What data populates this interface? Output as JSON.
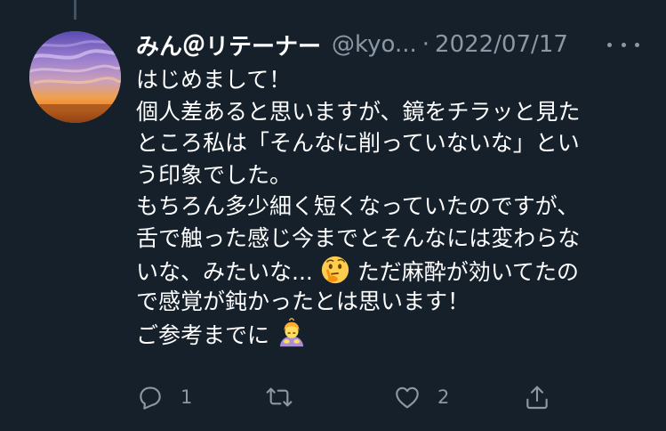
{
  "tweet": {
    "display_name": "みん＠リテーナー",
    "handle": "@kyo...",
    "separator": "·",
    "date": "2022/07/17",
    "body_lines": [
      "はじめまして！",
      "個人差あると思いますが、鏡をチラッと見た",
      "ところ私は「そんなに削っていないな」とい",
      "う印象でした。",
      "もちろん多少細く短くなっていたのですが、",
      "舌で触った感じ今までとそんなには変わらな",
      [
        "いな、みたいな...",
        "ただ麻酔が効いてたの"
      ],
      "で感覚が鈍かったとは思います！",
      "ご参考までに"
    ],
    "emojis": [
      "thinking-face",
      "person-bowing"
    ]
  },
  "actions": {
    "reply_count": "1",
    "retweet_count": "",
    "like_count": "2"
  },
  "colors": {
    "background": "#15202b",
    "text": "#ffffff",
    "secondary": "#8b98a5",
    "thread_line": "#3d5466"
  }
}
